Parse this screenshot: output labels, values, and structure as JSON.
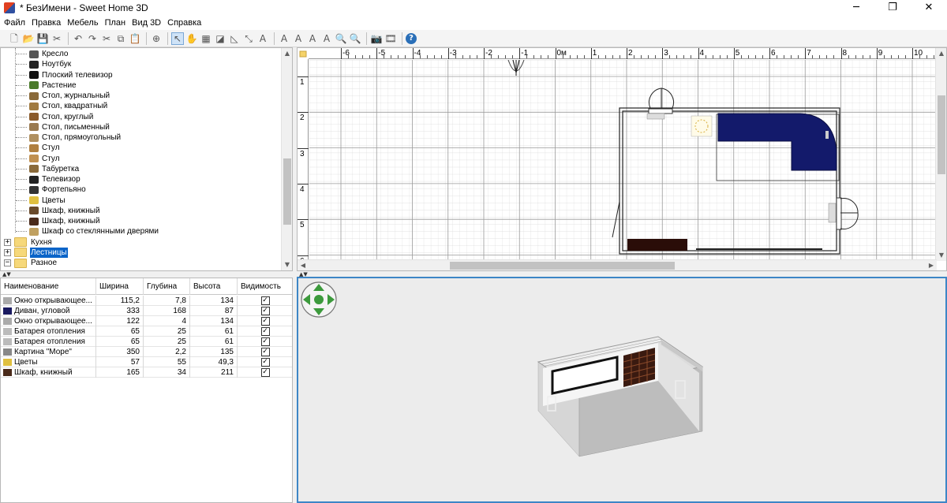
{
  "window": {
    "title": "* БезИмени - Sweet Home 3D",
    "minimize": "─",
    "maximize": "❐",
    "close": "✕"
  },
  "menu": [
    "Файл",
    "Правка",
    "Мебель",
    "План",
    "Вид 3D",
    "Справка"
  ],
  "toolbar": {
    "icons": [
      {
        "name": "new-home-icon",
        "glyph": "🗋"
      },
      {
        "name": "open-icon",
        "glyph": "📂"
      },
      {
        "name": "save-icon",
        "glyph": "💾"
      },
      {
        "name": "preferences-icon",
        "glyph": "✂"
      },
      {
        "sep": true
      },
      {
        "name": "undo-icon",
        "glyph": "↶"
      },
      {
        "name": "redo-icon",
        "glyph": "↷"
      },
      {
        "name": "cut-icon",
        "glyph": "✂"
      },
      {
        "name": "copy-icon",
        "glyph": "⧉"
      },
      {
        "name": "paste-icon",
        "glyph": "📋"
      },
      {
        "sep": true
      },
      {
        "name": "add-furniture-icon",
        "glyph": "⊕"
      },
      {
        "sep": true
      },
      {
        "name": "select-mode-icon",
        "glyph": "↖",
        "active": true
      },
      {
        "name": "pan-mode-icon",
        "glyph": "✋"
      },
      {
        "name": "create-walls-icon",
        "glyph": "▦"
      },
      {
        "name": "create-rooms-icon",
        "glyph": "◪"
      },
      {
        "name": "create-polylines-icon",
        "glyph": "◺"
      },
      {
        "name": "create-dimensions-icon",
        "glyph": "⤡"
      },
      {
        "name": "add-text-icon",
        "glyph": "A"
      },
      {
        "sep": true
      },
      {
        "name": "increase-text-icon",
        "glyph": "A"
      },
      {
        "name": "decrease-text-icon",
        "glyph": "A"
      },
      {
        "name": "bold-text-icon",
        "glyph": "A"
      },
      {
        "name": "italic-text-icon",
        "glyph": "A"
      },
      {
        "name": "zoom-in-icon",
        "glyph": "🔍"
      },
      {
        "name": "zoom-out-icon",
        "glyph": "🔍"
      },
      {
        "sep": true
      },
      {
        "name": "create-photo-icon",
        "glyph": "📷"
      },
      {
        "name": "create-video-icon",
        "glyph": "🎞"
      },
      {
        "sep": true
      },
      {
        "name": "help-icon",
        "glyph": "?"
      }
    ]
  },
  "catalog": {
    "items": [
      {
        "label": "Кресло",
        "icon": "armchair-icon",
        "color": "#555"
      },
      {
        "label": "Ноутбук",
        "icon": "laptop-icon",
        "color": "#222"
      },
      {
        "label": "Плоский телевизор",
        "icon": "flat-tv-icon",
        "color": "#111"
      },
      {
        "label": "Растение",
        "icon": "plant-icon",
        "color": "#4a7a2a"
      },
      {
        "label": "Стол, журнальный",
        "icon": "coffee-table-icon",
        "color": "#8a6a3a"
      },
      {
        "label": "Стол, квадратный",
        "icon": "square-table-icon",
        "color": "#a07a40"
      },
      {
        "label": "Стол, круглый",
        "icon": "round-table-icon",
        "color": "#8a5a2a"
      },
      {
        "label": "Стол, письменный",
        "icon": "desk-icon",
        "color": "#9a7a50"
      },
      {
        "label": "Стол, прямоугольный",
        "icon": "rect-table-icon",
        "color": "#b09060"
      },
      {
        "label": "Стул",
        "icon": "chair-icon",
        "color": "#b08040"
      },
      {
        "label": "Стул",
        "icon": "chair-icon",
        "color": "#c09050"
      },
      {
        "label": "Табуретка",
        "icon": "stool-icon",
        "color": "#8a6a3a"
      },
      {
        "label": "Телевизор",
        "icon": "tv-icon",
        "color": "#222"
      },
      {
        "label": "Фортепьяно",
        "icon": "piano-icon",
        "color": "#333"
      },
      {
        "label": "Цветы",
        "icon": "flowers-icon",
        "color": "#e0c040"
      },
      {
        "label": "Шкаф, книжный",
        "icon": "bookcase-icon",
        "color": "#6a4a2a"
      },
      {
        "label": "Шкаф, книжный",
        "icon": "bookcase-icon",
        "color": "#4a2a1a"
      },
      {
        "label": "Шкаф со стеклянными дверями",
        "icon": "glass-cabinet-icon",
        "color": "#c0a060"
      }
    ],
    "categories": [
      {
        "label": "Кухня",
        "expander": "+"
      },
      {
        "label": "Лестницы",
        "expander": "+",
        "selected": true
      },
      {
        "label": "Разное",
        "expander": "−"
      }
    ],
    "partial_item": "Батарея отопления"
  },
  "furniture_table": {
    "columns": [
      "Наименование",
      "Ширина",
      "Глубина",
      "Высота",
      "Видимость"
    ],
    "rows": [
      {
        "name": "Окно открывающее...",
        "width": "115,2",
        "depth": "7,8",
        "height": "134",
        "visible": "✓",
        "icon": "window-icon",
        "color": "#aaa"
      },
      {
        "name": "Диван, угловой",
        "width": "333",
        "depth": "168",
        "height": "87",
        "visible": "✓",
        "icon": "sofa-icon",
        "color": "#1a1a60"
      },
      {
        "name": "Окно открывающее...",
        "width": "122",
        "depth": "4",
        "height": "134",
        "visible": "✓",
        "icon": "window-icon",
        "color": "#aaa"
      },
      {
        "name": "Батарея отопления",
        "width": "65",
        "depth": "25",
        "height": "61",
        "visible": "✓",
        "icon": "radiator-icon",
        "color": "#bbb"
      },
      {
        "name": "Батарея отопления",
        "width": "65",
        "depth": "25",
        "height": "61",
        "visible": "✓",
        "icon": "radiator-icon",
        "color": "#bbb"
      },
      {
        "name": "Картина \"Море\"",
        "width": "350",
        "depth": "2,2",
        "height": "135",
        "visible": "✓",
        "icon": "picture-icon",
        "color": "#888"
      },
      {
        "name": "Цветы",
        "width": "57",
        "depth": "55",
        "height": "49,3",
        "visible": "✓",
        "icon": "flowers-icon",
        "color": "#e0c040"
      },
      {
        "name": "Шкаф, книжный",
        "width": "165",
        "depth": "34",
        "height": "211",
        "visible": "✓",
        "icon": "bookcase-icon",
        "color": "#4a2a1a"
      }
    ]
  },
  "plan": {
    "ruler_x_labels": [
      "-6",
      "-5",
      "-4",
      "-3",
      "-2",
      "-1",
      "0м",
      "1",
      "2",
      "3",
      "4",
      "5",
      "6",
      "7",
      "8",
      "9",
      "10"
    ],
    "ruler_y_labels": [
      "1",
      "2",
      "3",
      "4",
      "5",
      "6"
    ],
    "sofa_color": "#131a6b",
    "bookcase_color": "#2a0d08"
  },
  "view3d": {
    "nav_color": "#3c9a3c"
  }
}
